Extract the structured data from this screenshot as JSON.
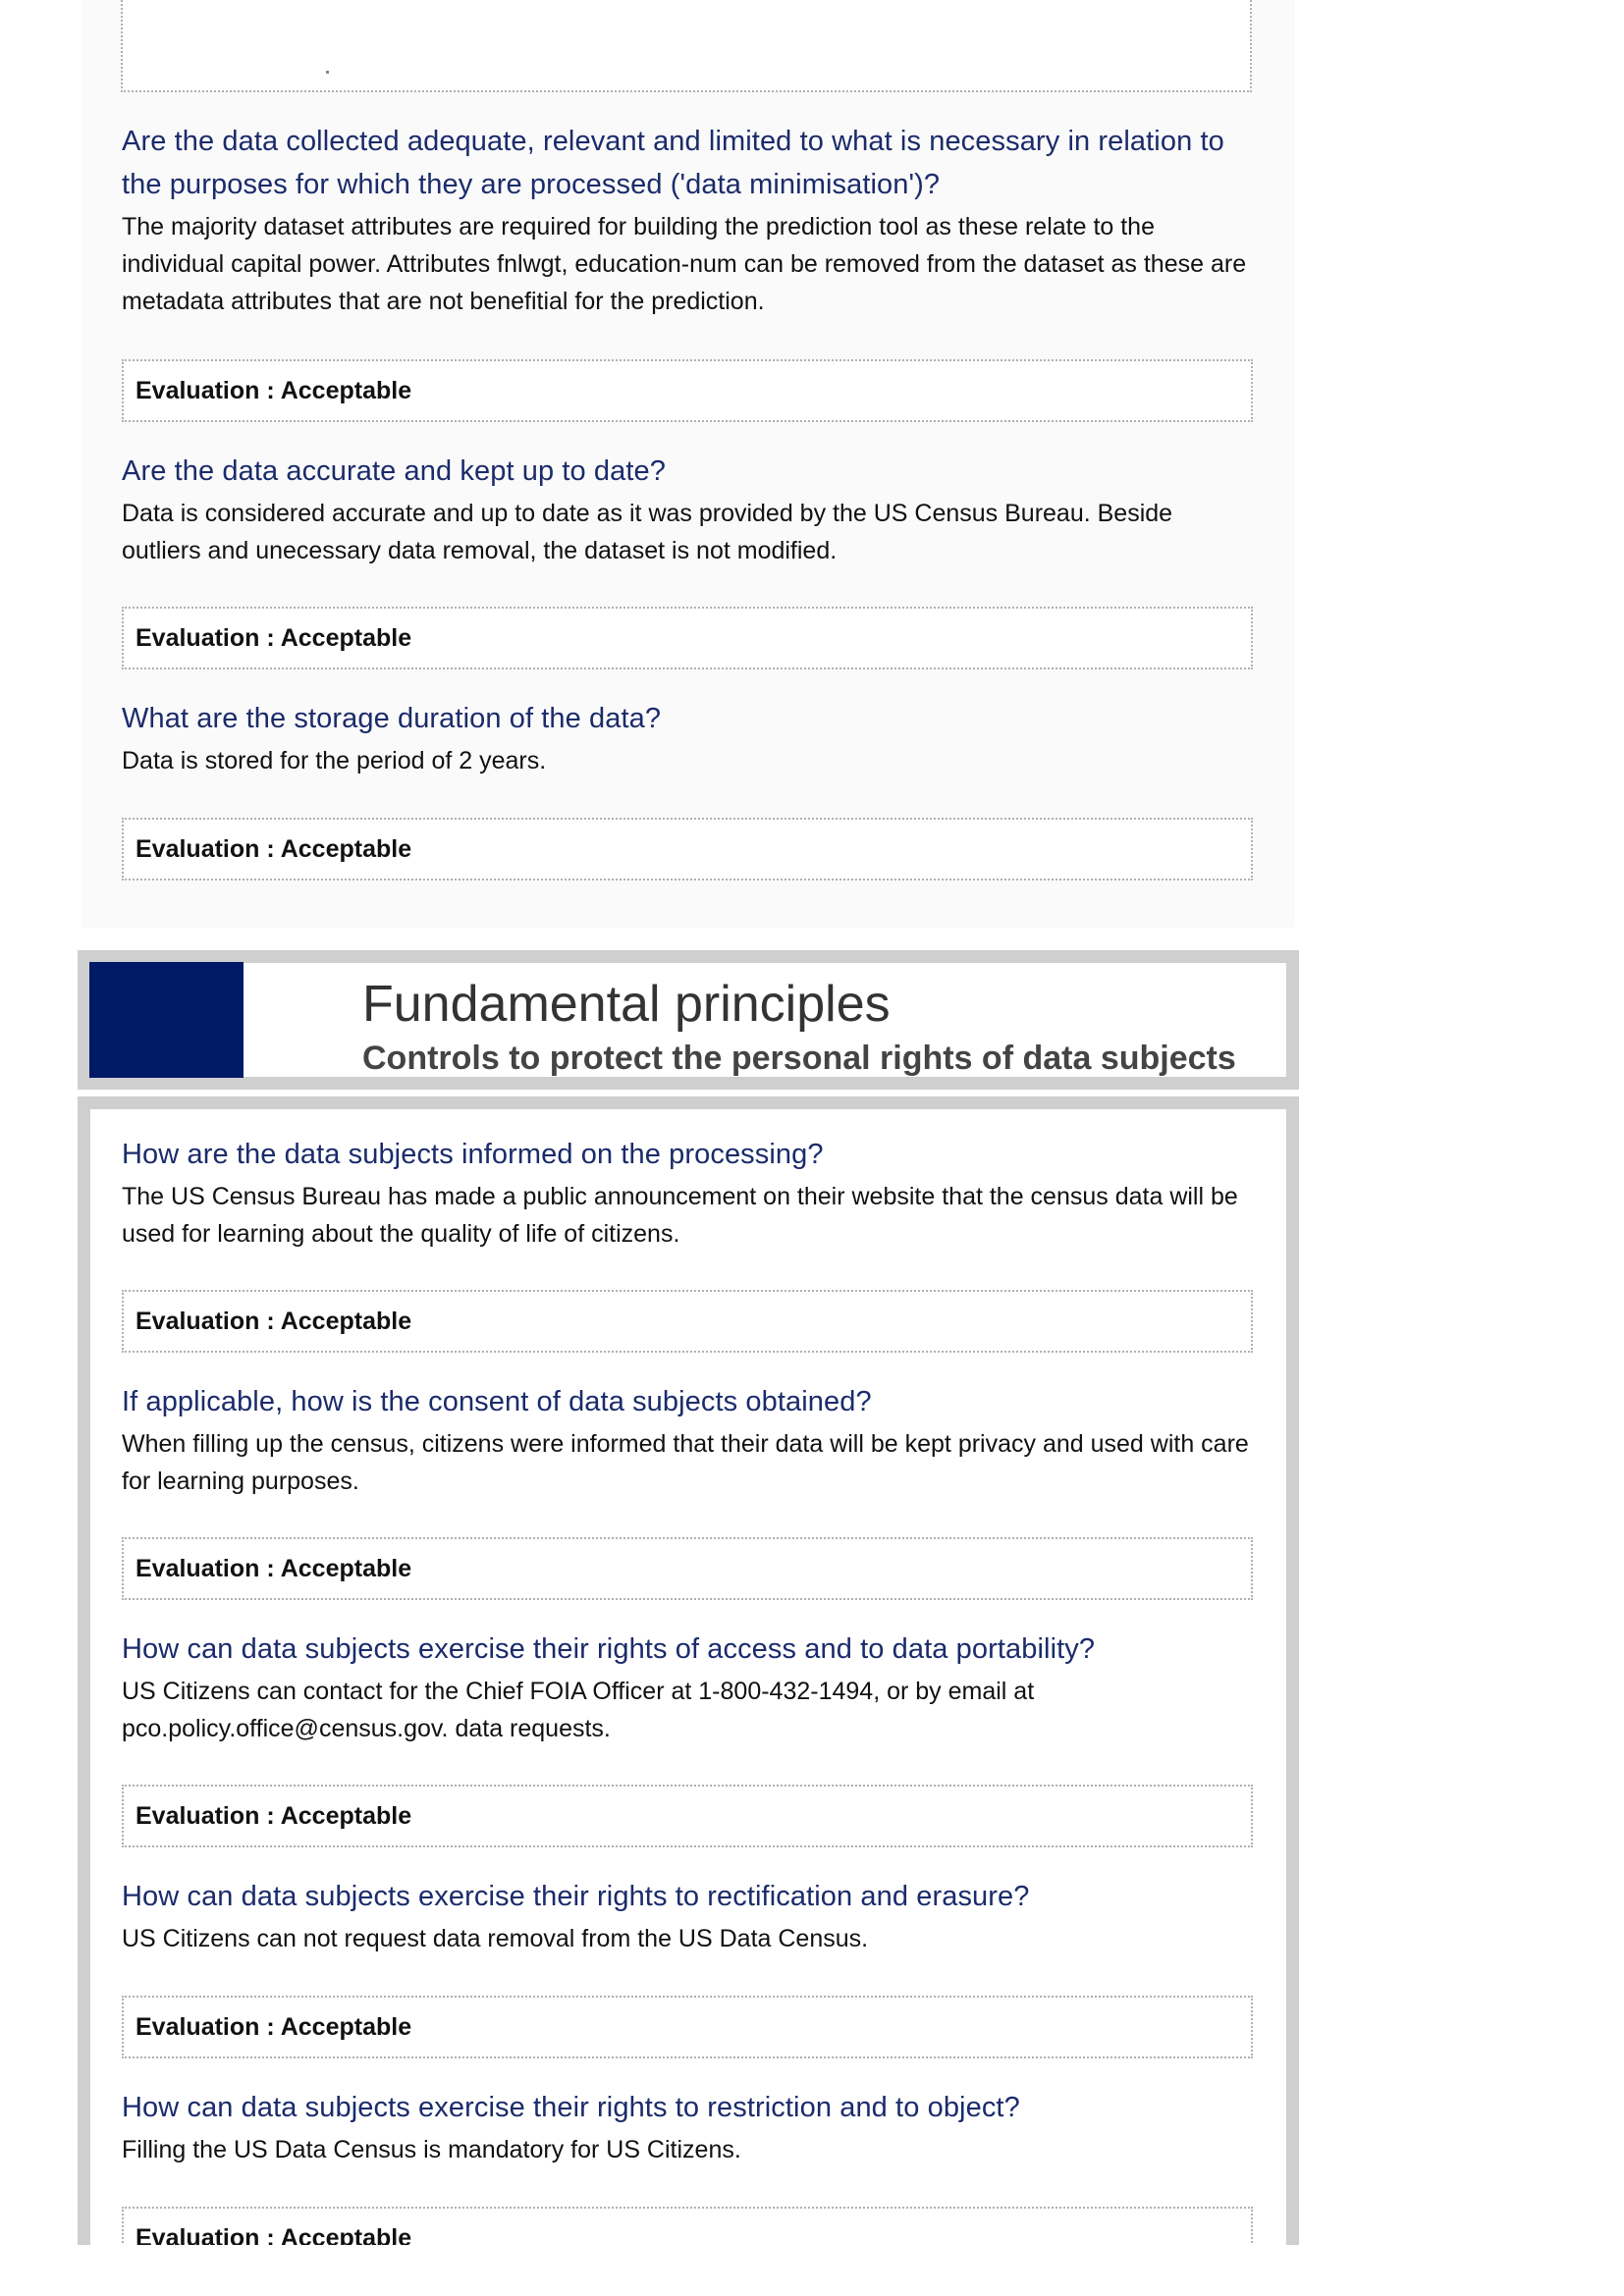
{
  "top_items": [
    {
      "question": "Are the data collected adequate, relevant and limited to what is necessary in relation to the purposes for which they are processed ('data minimisation')?",
      "answer": "The majority dataset attributes are required for building the prediction tool as these relate to the individual capital power. Attributes fnlwgt, education-num can be removed from the dataset as these are metadata attributes that are not benefitial for the prediction.",
      "evaluation": "Evaluation : Acceptable"
    },
    {
      "question": "Are the data accurate and kept up to date?",
      "answer": "Data is considered accurate and up to date as it was provided by the US Census Bureau. Beside outliers and unecessary data removal, the dataset is not modified.",
      "evaluation": "Evaluation : Acceptable"
    },
    {
      "question": "What are the storage duration of the data?",
      "answer": "Data is stored for the period of 2 years.",
      "evaluation": "Evaluation : Acceptable"
    }
  ],
  "section": {
    "title": "Fundamental principles",
    "subtitle": "Controls to protect the personal rights of data subjects",
    "accent_color": "#001a66",
    "frame_color": "#cfcfcf"
  },
  "section_items": [
    {
      "question": "How are the data subjects informed on the processing?",
      "answer": "The US Census Bureau has made a public announcement on their website that the census data will be used for learning about the quality of life of citizens.",
      "evaluation": "Evaluation : Acceptable"
    },
    {
      "question": "If applicable, how is the consent of data subjects obtained?",
      "answer": "When filling up the census, citizens were informed that their data will be kept privacy and used with care for learning purposes.",
      "evaluation": "Evaluation : Acceptable"
    },
    {
      "question": "How can data subjects exercise their rights of access and to data portability?",
      "answer": "US Citizens can contact for the Chief FOIA Officer at 1-800-432-1494, or by email at pco.policy.office@census.gov. data requests.",
      "evaluation": "Evaluation : Acceptable"
    },
    {
      "question": "How can data subjects exercise their rights to rectification and erasure?",
      "answer": "US Citizens can not request data removal from the US Data Census.",
      "evaluation": "Evaluation : Acceptable"
    },
    {
      "question": "How can data subjects exercise their rights to restriction and to object?",
      "answer": "Filling the US Data Census is mandatory for US Citizens.",
      "evaluation": "Evaluation : Acceptable"
    }
  ],
  "colors": {
    "question_text": "#1b2b6b",
    "body_text": "#111111",
    "dotted_border": "#b0b0b0"
  }
}
